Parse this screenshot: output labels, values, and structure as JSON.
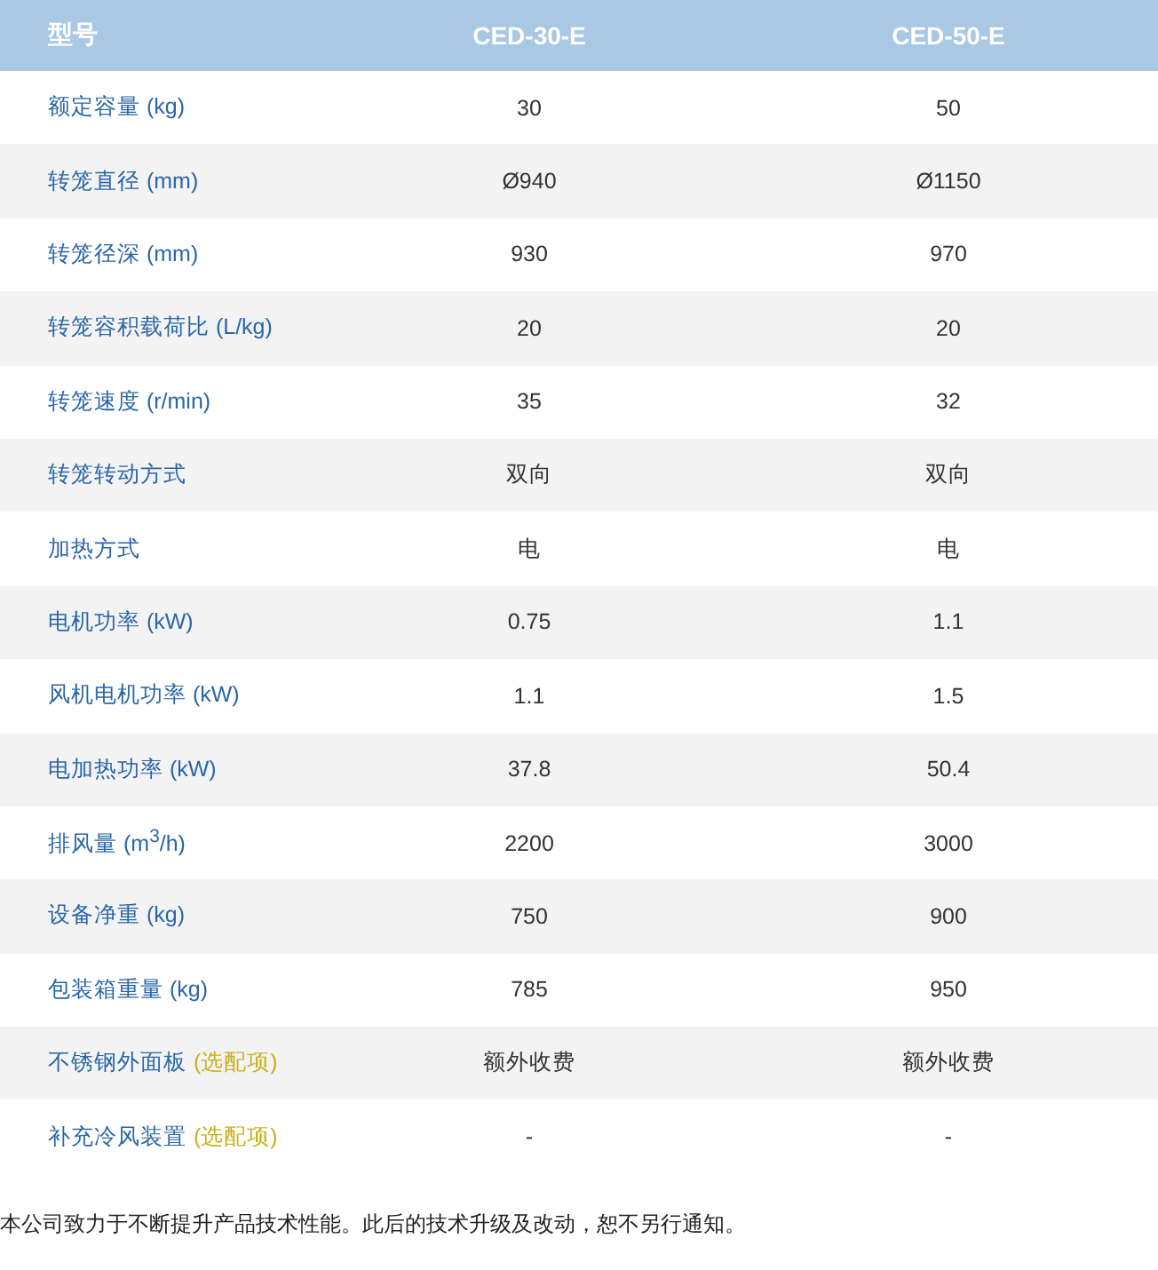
{
  "table": {
    "columns": [
      "型号",
      "CED-30-E",
      "CED-50-E"
    ],
    "rows": [
      {
        "label": "额定容量 (kg)",
        "values": [
          "30",
          "50"
        ]
      },
      {
        "label": "转笼直径 (mm)",
        "values": [
          "Ø940",
          "Ø1150"
        ]
      },
      {
        "label": "转笼径深 (mm)",
        "values": [
          "930",
          "970"
        ]
      },
      {
        "label": "转笼容积载荷比 (L/kg)",
        "values": [
          "20",
          "20"
        ]
      },
      {
        "label": "转笼速度 (r/min)",
        "values": [
          "35",
          "32"
        ]
      },
      {
        "label": "转笼转动方式",
        "values": [
          "双向",
          "双向"
        ]
      },
      {
        "label": "加热方式",
        "values": [
          "电",
          "电"
        ]
      },
      {
        "label": "电机功率 (kW)",
        "values": [
          "0.75",
          "1.1"
        ]
      },
      {
        "label": "风机电机功率 (kW)",
        "values": [
          "1.1",
          "1.5"
        ]
      },
      {
        "label": "电加热功率 (kW)",
        "values": [
          "37.8",
          "50.4"
        ]
      },
      {
        "label": "排风量 (m$^{3}$/h)",
        "values": [
          "2200",
          "3000"
        ]
      },
      {
        "label": "设备净重 (kg)",
        "values": [
          "750",
          "900"
        ]
      },
      {
        "label": "包装箱重量 (kg)",
        "values": [
          "785",
          "950"
        ]
      },
      {
        "label": "不锈钢外面板",
        "note": "(选配项)",
        "values": [
          "额外收费",
          "额外收费"
        ]
      },
      {
        "label": "补充冷风装置",
        "note": "(选配项)",
        "values": [
          "-",
          "-"
        ]
      }
    ]
  },
  "footer": "本公司致力于不断提升产品技术性能。此后的技术升级及改动，恕不另行通知。"
}
